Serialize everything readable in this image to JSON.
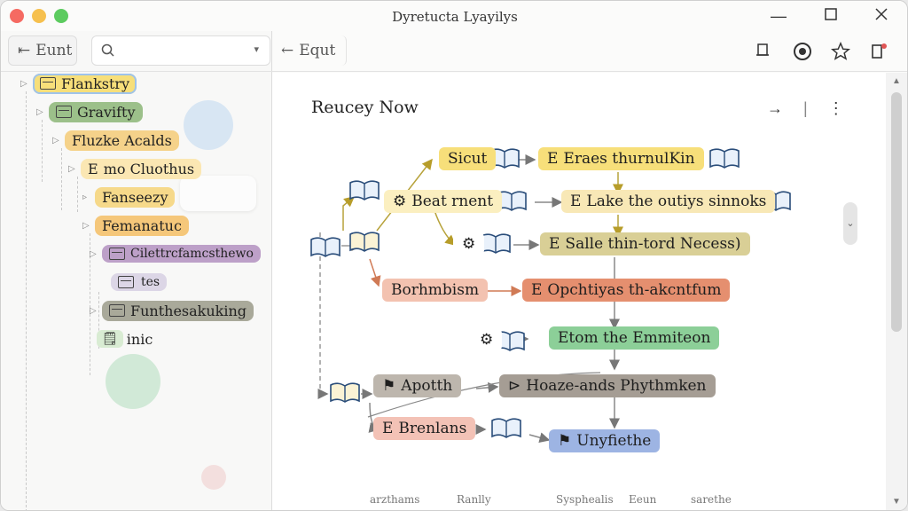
{
  "window": {
    "title": "Dyretucta Lyayilys"
  },
  "sidebar": {
    "edit_label": "Eunt",
    "search": {
      "placeholder": "",
      "value": ""
    },
    "tree": [
      {
        "label": "Flankstry"
      },
      {
        "label": "Gravifty"
      },
      {
        "label": "Fluzke Acalds"
      },
      {
        "label": "mo Cluothus"
      },
      {
        "label": "Fanseezy"
      },
      {
        "label": "Femanatuc"
      },
      {
        "label": "Cilettrcfamcsthewo"
      },
      {
        "label": "tes"
      },
      {
        "label": "Funthesakuking"
      },
      {
        "label": "inic"
      }
    ]
  },
  "main": {
    "edit_label": "Equt",
    "canvas_title": "Reucey Now",
    "flow": {
      "sicut": "Sicut",
      "beat_rnent": "Beat rnent",
      "eraes": "Eraes thurnulKin",
      "lake": "Lake the outiys sinnoks",
      "salle": "Salle thin-tord Necess)",
      "borhmbism": "Borhmbism",
      "opchtiyas": "Opchtiyas th-akcntfum",
      "etom": "Etom the Emmiteon",
      "apotth": "Apotth",
      "hoaze": "Hoaze-ands Phythmken",
      "brenlans": "Brenlans",
      "unyfiethe": "Unyfiethe"
    },
    "status": {
      "left": "arzthams",
      "mid1": "Ranlly",
      "mid2": "Sysphealis",
      "mid3": "Eeun",
      "right": "sarethe"
    }
  },
  "colors": {
    "yellow": "#f7df7a",
    "green": "#9cc08a",
    "orange": "#f5c77a",
    "purple": "#bda0c8",
    "brown": "#cdb88a",
    "red": "#f0a48d",
    "mint": "#9ad5a6",
    "gray": "#b7aea3",
    "blue": "#a6bce6"
  },
  "icons": [
    "edit-icon",
    "search-icon",
    "chevron-down-icon",
    "folder-icon",
    "book-icon",
    "gear-icon",
    "pin-icon",
    "star-icon",
    "panel-icon",
    "minimize-icon",
    "maximize-icon",
    "close-icon",
    "more-icon",
    "arrow-right-icon"
  ]
}
